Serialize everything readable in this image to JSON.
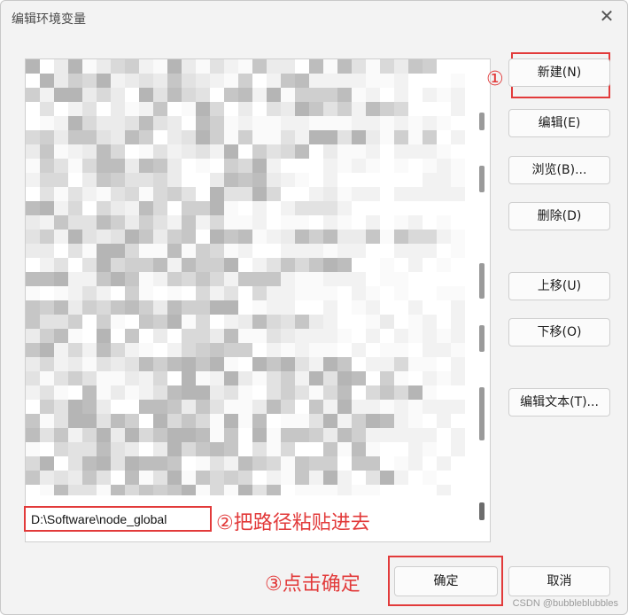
{
  "window": {
    "title": "编辑环境变量",
    "close_glyph": "✕"
  },
  "list": {
    "edit_value": "D:\\Software\\node_global"
  },
  "buttons": {
    "new": "新建(N)",
    "edit": "编辑(E)",
    "browse": "浏览(B)...",
    "delete": "删除(D)",
    "move_up": "上移(U)",
    "move_down": "下移(O)",
    "edit_text": "编辑文本(T)...",
    "ok": "确定",
    "cancel": "取消"
  },
  "annotations": {
    "step1": "①",
    "step2": "②把路径粘贴进去",
    "step3": "③点击确定"
  },
  "watermark": "CSDN @bubbleblubbles",
  "colors": {
    "annotation": "#e23a3a",
    "dialog_bg": "#f3f3f3"
  }
}
